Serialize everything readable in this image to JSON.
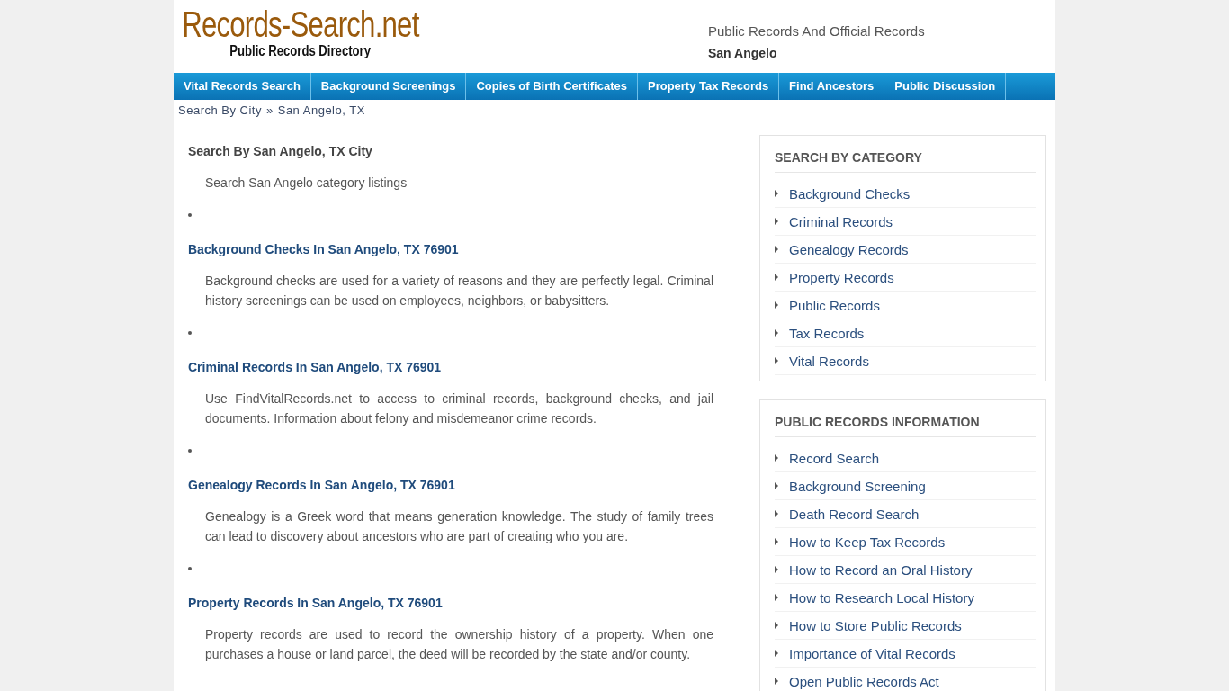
{
  "logo": {
    "title": "Records-Search.net",
    "subtitle": "Public Records Directory"
  },
  "header": {
    "tagline": "Public Records And Official Records",
    "city": "San Angelo"
  },
  "nav": [
    "Vital Records Search",
    "Background Screenings",
    "Copies of Birth Certificates",
    "Property Tax Records",
    "Find Ancestors",
    "Public Discussion"
  ],
  "breadcrumb": {
    "link": "Search By City",
    "separator": "»",
    "current": "San Angelo, TX"
  },
  "main": {
    "heading": "Search By San Angelo, TX City",
    "intro": "Search San Angelo category listings",
    "sections": [
      {
        "title": "Background Checks In San Angelo, TX 76901",
        "text": "Background checks are used for a variety of reasons and they are perfectly legal. Criminal history screenings can be used on employees, neighbors, or babysitters."
      },
      {
        "title": "Criminal Records In San Angelo, TX 76901",
        "text": "Use FindVitalRecords.net to access to criminal records, background checks, and jail documents. Information about felony and misdemeanor crime records."
      },
      {
        "title": "Genealogy Records In San Angelo, TX 76901",
        "text": "Genealogy is a Greek word that means generation knowledge. The study of family trees can lead to discovery about ancestors who are part of creating who you are."
      },
      {
        "title": "Property Records In San Angelo, TX 76901",
        "text": "Property records are used to record the ownership history of a property. When one purchases a house or land parcel, the deed will be recorded by the state and/or county."
      }
    ]
  },
  "sidebar": [
    {
      "title": "SEARCH BY CATEGORY",
      "items": [
        "Background Checks",
        "Criminal Records",
        "Genealogy Records",
        "Property Records",
        "Public Records",
        "Tax Records",
        "Vital Records"
      ]
    },
    {
      "title": "PUBLIC RECORDS INFORMATION",
      "items": [
        "Record Search",
        "Background Screening",
        "Death Record Search",
        "How to Keep Tax Records",
        "How to Record an Oral History",
        "How to Research Local History",
        "How to Store Public Records",
        "Importance of Vital Records",
        "Open Public Records Act"
      ]
    }
  ]
}
